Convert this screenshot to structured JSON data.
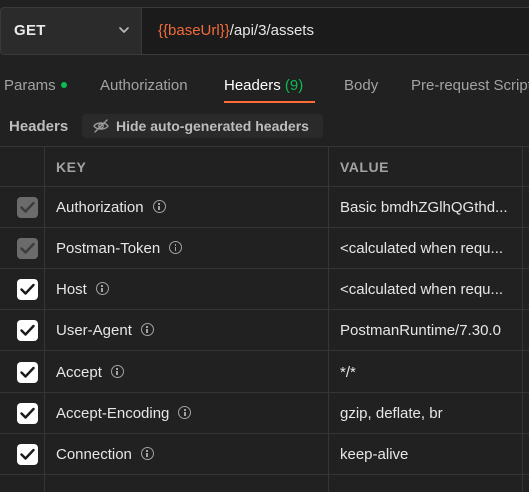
{
  "request": {
    "method": "GET",
    "url_variable": "{{baseUrl}}",
    "url_path": "/api/3/assets"
  },
  "tabs": [
    {
      "label": "Params"
    },
    {
      "label": "Authorization"
    },
    {
      "label": "Headers",
      "count": "(9)"
    },
    {
      "label": "Body"
    },
    {
      "label": "Pre-request Script"
    }
  ],
  "headers_section": {
    "title": "Headers",
    "hide_auto_label": "Hide auto-generated headers"
  },
  "table": {
    "columns": [
      "KEY",
      "VALUE"
    ],
    "rows": [
      {
        "key": "Authorization",
        "value": "Basic bmdhZGlhQGthd...",
        "checked": true,
        "auto": true
      },
      {
        "key": "Postman-Token",
        "value": "<calculated when requ...",
        "checked": true,
        "auto": true
      },
      {
        "key": "Host",
        "value": "<calculated when requ...",
        "checked": true,
        "auto": false
      },
      {
        "key": "User-Agent",
        "value": "PostmanRuntime/7.30.0",
        "checked": true,
        "auto": false
      },
      {
        "key": "Accept",
        "value": "*/*",
        "checked": true,
        "auto": false
      },
      {
        "key": "Accept-Encoding",
        "value": "gzip, deflate, br",
        "checked": true,
        "auto": false
      },
      {
        "key": "Connection",
        "value": "keep-alive",
        "checked": true,
        "auto": false
      }
    ]
  },
  "colors": {
    "accent": "#ff6c37",
    "variable": "#f26b3a",
    "status_green": "#0cbb52",
    "background": "#212121"
  }
}
